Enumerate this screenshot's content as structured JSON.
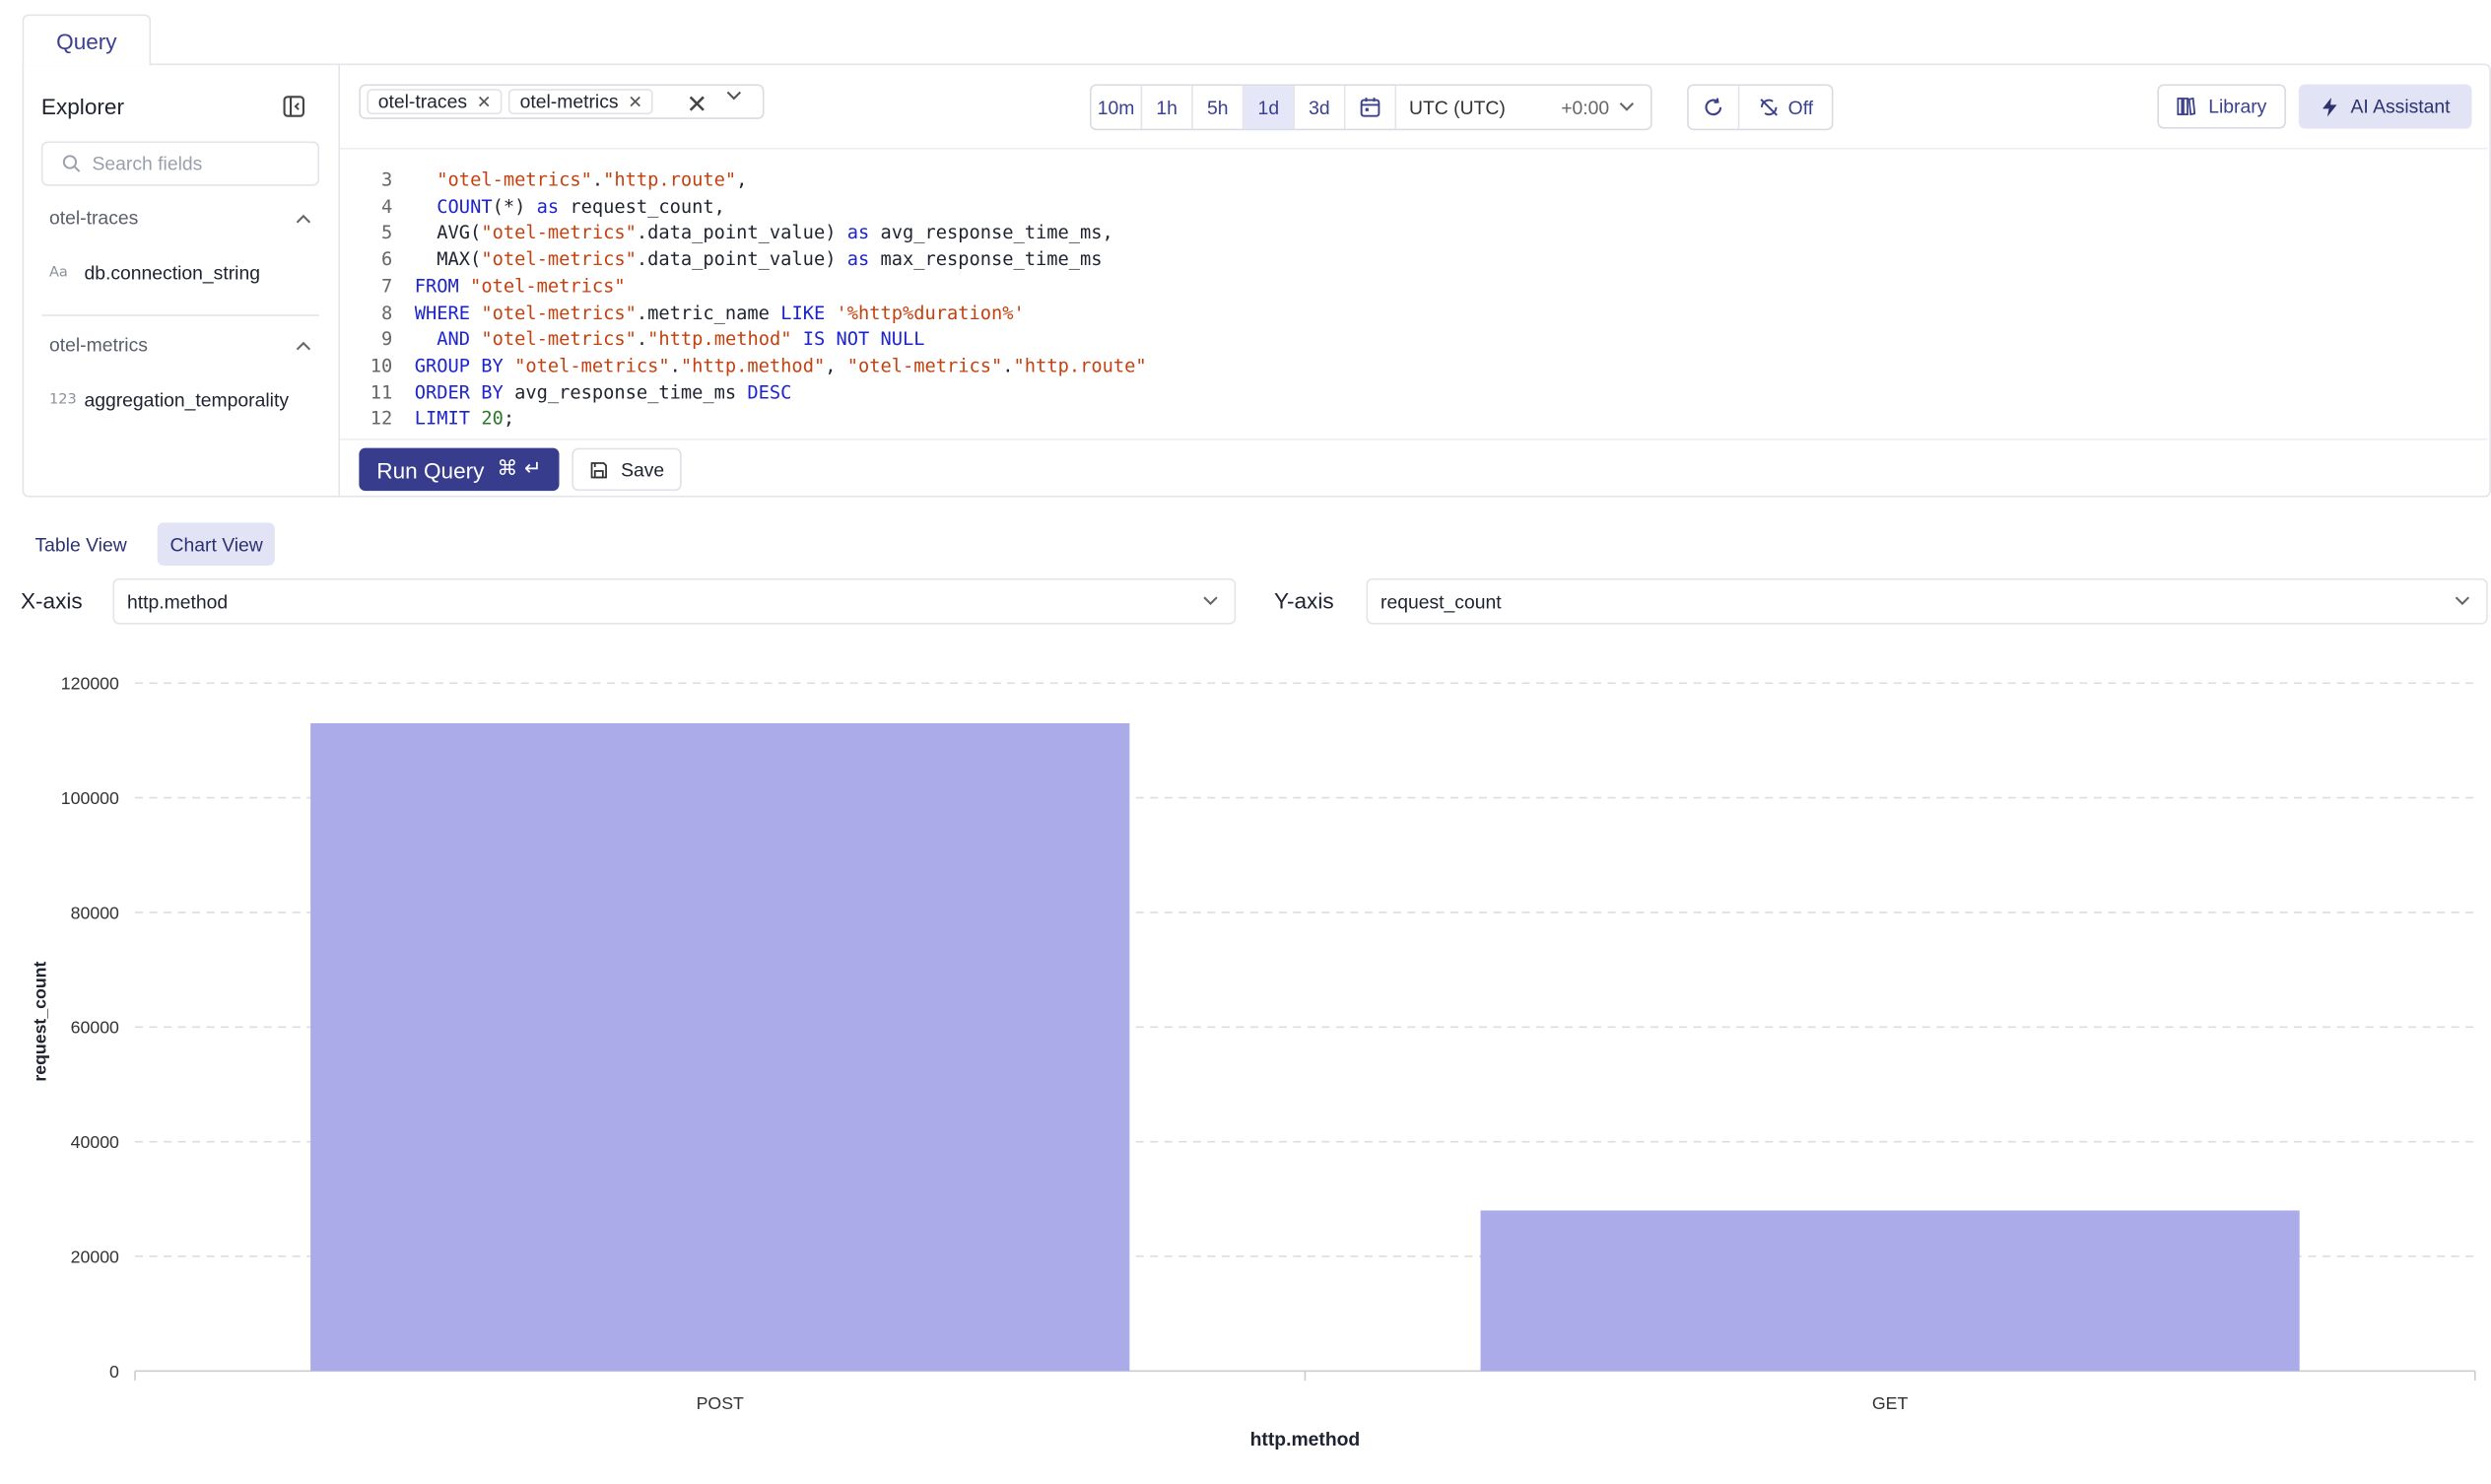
{
  "tab": {
    "label": "Query"
  },
  "explorer": {
    "title": "Explorer",
    "search_placeholder": "Search fields",
    "groups": [
      {
        "name": "otel-traces",
        "fields": [
          {
            "type": "Aa",
            "name": "db.connection_string"
          }
        ]
      },
      {
        "name": "otel-metrics",
        "fields": [
          {
            "type": "123",
            "name": "aggregation_temporality"
          }
        ]
      }
    ]
  },
  "sources": {
    "chips": [
      "otel-traces",
      "otel-metrics"
    ]
  },
  "time_range": {
    "options": [
      "10m",
      "1h",
      "5h",
      "1d",
      "3d"
    ],
    "selected": "1d",
    "timezone": "UTC (UTC)",
    "offset": "+0:00"
  },
  "refresh": {
    "auto_label": "Off"
  },
  "toolbar": {
    "library_label": "Library",
    "ai_label": "AI Assistant"
  },
  "editor": {
    "lines": [
      {
        "n": "3",
        "tokens": [
          [
            "",
            "  "
          ],
          [
            "str",
            "\"otel-metrics\""
          ],
          [
            "",
            "."
          ],
          [
            "str",
            "\"http.route\""
          ],
          [
            "",
            ","
          ]
        ]
      },
      {
        "n": "4",
        "tokens": [
          [
            "",
            "  "
          ],
          [
            "kw",
            "COUNT"
          ],
          [
            "",
            "(*) "
          ],
          [
            "kw",
            "as"
          ],
          [
            "",
            " request_count,"
          ]
        ]
      },
      {
        "n": "5",
        "tokens": [
          [
            "",
            "  AVG("
          ],
          [
            "str",
            "\"otel-metrics\""
          ],
          [
            "",
            ".data_point_value) "
          ],
          [
            "kw",
            "as"
          ],
          [
            "",
            " avg_response_time_ms,"
          ]
        ]
      },
      {
        "n": "6",
        "tokens": [
          [
            "",
            "  MAX("
          ],
          [
            "str",
            "\"otel-metrics\""
          ],
          [
            "",
            ".data_point_value) "
          ],
          [
            "kw",
            "as"
          ],
          [
            "",
            " max_response_time_ms"
          ]
        ]
      },
      {
        "n": "7",
        "tokens": [
          [
            "kw",
            "FROM"
          ],
          [
            "",
            " "
          ],
          [
            "str",
            "\"otel-metrics\""
          ]
        ]
      },
      {
        "n": "8",
        "tokens": [
          [
            "kw",
            "WHERE"
          ],
          [
            "",
            " "
          ],
          [
            "str",
            "\"otel-metrics\""
          ],
          [
            "",
            ".metric_name "
          ],
          [
            "kw",
            "LIKE"
          ],
          [
            "",
            " "
          ],
          [
            "str",
            "'%http%duration%'"
          ]
        ]
      },
      {
        "n": "9",
        "tokens": [
          [
            "",
            "  "
          ],
          [
            "kw",
            "AND"
          ],
          [
            "",
            " "
          ],
          [
            "str",
            "\"otel-metrics\""
          ],
          [
            "",
            "."
          ],
          [
            "str",
            "\"http.method\""
          ],
          [
            "",
            " "
          ],
          [
            "kw",
            "IS NOT NULL"
          ]
        ]
      },
      {
        "n": "10",
        "tokens": [
          [
            "kw",
            "GROUP BY"
          ],
          [
            "",
            " "
          ],
          [
            "str",
            "\"otel-metrics\""
          ],
          [
            "",
            "."
          ],
          [
            "str",
            "\"http.method\""
          ],
          [
            "",
            ", "
          ],
          [
            "str",
            "\"otel-metrics\""
          ],
          [
            "",
            "."
          ],
          [
            "str",
            "\"http.route\""
          ]
        ]
      },
      {
        "n": "11",
        "tokens": [
          [
            "kw",
            "ORDER BY"
          ],
          [
            "",
            " avg_response_time_ms "
          ],
          [
            "kw",
            "DESC"
          ]
        ]
      },
      {
        "n": "12",
        "tokens": [
          [
            "kw",
            "LIMIT"
          ],
          [
            "",
            " "
          ],
          [
            "num",
            "20"
          ],
          [
            "",
            ";"
          ]
        ]
      }
    ]
  },
  "actions": {
    "run_label": "Run Query",
    "run_shortcut": "⌘ ↵",
    "save_label": "Save"
  },
  "views": {
    "table_label": "Table View",
    "chart_label": "Chart View",
    "active": "chart"
  },
  "axes": {
    "x_label": "X-axis",
    "x_value": "http.method",
    "y_label": "Y-axis",
    "y_value": "request_count"
  },
  "colors": {
    "accent": "#373c8c",
    "bar": "#acabea"
  },
  "chart_data": {
    "type": "bar",
    "categories": [
      "POST",
      "GET"
    ],
    "values": [
      113000,
      28000
    ],
    "xlabel": "http.method",
    "ylabel": "request_count",
    "ylim": [
      0,
      120000
    ],
    "yticks": [
      0,
      20000,
      40000,
      60000,
      80000,
      100000,
      120000
    ],
    "grid": true
  }
}
